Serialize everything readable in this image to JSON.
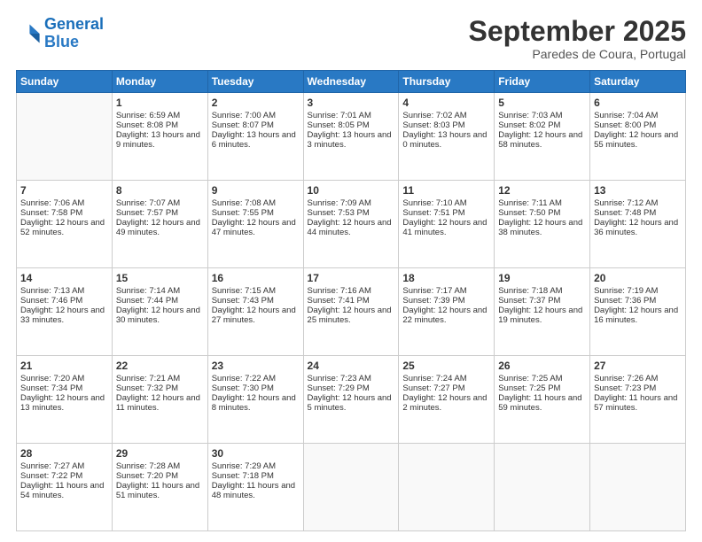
{
  "logo": {
    "line1": "General",
    "line2": "Blue"
  },
  "header": {
    "month": "September 2025",
    "location": "Paredes de Coura, Portugal"
  },
  "days_of_week": [
    "Sunday",
    "Monday",
    "Tuesday",
    "Wednesday",
    "Thursday",
    "Friday",
    "Saturday"
  ],
  "weeks": [
    [
      {
        "day": "",
        "sunrise": "",
        "sunset": "",
        "daylight": "",
        "empty": true
      },
      {
        "day": "1",
        "sunrise": "Sunrise: 6:59 AM",
        "sunset": "Sunset: 8:08 PM",
        "daylight": "Daylight: 13 hours and 9 minutes."
      },
      {
        "day": "2",
        "sunrise": "Sunrise: 7:00 AM",
        "sunset": "Sunset: 8:07 PM",
        "daylight": "Daylight: 13 hours and 6 minutes."
      },
      {
        "day": "3",
        "sunrise": "Sunrise: 7:01 AM",
        "sunset": "Sunset: 8:05 PM",
        "daylight": "Daylight: 13 hours and 3 minutes."
      },
      {
        "day": "4",
        "sunrise": "Sunrise: 7:02 AM",
        "sunset": "Sunset: 8:03 PM",
        "daylight": "Daylight: 13 hours and 0 minutes."
      },
      {
        "day": "5",
        "sunrise": "Sunrise: 7:03 AM",
        "sunset": "Sunset: 8:02 PM",
        "daylight": "Daylight: 12 hours and 58 minutes."
      },
      {
        "day": "6",
        "sunrise": "Sunrise: 7:04 AM",
        "sunset": "Sunset: 8:00 PM",
        "daylight": "Daylight: 12 hours and 55 minutes."
      }
    ],
    [
      {
        "day": "7",
        "sunrise": "Sunrise: 7:06 AM",
        "sunset": "Sunset: 7:58 PM",
        "daylight": "Daylight: 12 hours and 52 minutes."
      },
      {
        "day": "8",
        "sunrise": "Sunrise: 7:07 AM",
        "sunset": "Sunset: 7:57 PM",
        "daylight": "Daylight: 12 hours and 49 minutes."
      },
      {
        "day": "9",
        "sunrise": "Sunrise: 7:08 AM",
        "sunset": "Sunset: 7:55 PM",
        "daylight": "Daylight: 12 hours and 47 minutes."
      },
      {
        "day": "10",
        "sunrise": "Sunrise: 7:09 AM",
        "sunset": "Sunset: 7:53 PM",
        "daylight": "Daylight: 12 hours and 44 minutes."
      },
      {
        "day": "11",
        "sunrise": "Sunrise: 7:10 AM",
        "sunset": "Sunset: 7:51 PM",
        "daylight": "Daylight: 12 hours and 41 minutes."
      },
      {
        "day": "12",
        "sunrise": "Sunrise: 7:11 AM",
        "sunset": "Sunset: 7:50 PM",
        "daylight": "Daylight: 12 hours and 38 minutes."
      },
      {
        "day": "13",
        "sunrise": "Sunrise: 7:12 AM",
        "sunset": "Sunset: 7:48 PM",
        "daylight": "Daylight: 12 hours and 36 minutes."
      }
    ],
    [
      {
        "day": "14",
        "sunrise": "Sunrise: 7:13 AM",
        "sunset": "Sunset: 7:46 PM",
        "daylight": "Daylight: 12 hours and 33 minutes."
      },
      {
        "day": "15",
        "sunrise": "Sunrise: 7:14 AM",
        "sunset": "Sunset: 7:44 PM",
        "daylight": "Daylight: 12 hours and 30 minutes."
      },
      {
        "day": "16",
        "sunrise": "Sunrise: 7:15 AM",
        "sunset": "Sunset: 7:43 PM",
        "daylight": "Daylight: 12 hours and 27 minutes."
      },
      {
        "day": "17",
        "sunrise": "Sunrise: 7:16 AM",
        "sunset": "Sunset: 7:41 PM",
        "daylight": "Daylight: 12 hours and 25 minutes."
      },
      {
        "day": "18",
        "sunrise": "Sunrise: 7:17 AM",
        "sunset": "Sunset: 7:39 PM",
        "daylight": "Daylight: 12 hours and 22 minutes."
      },
      {
        "day": "19",
        "sunrise": "Sunrise: 7:18 AM",
        "sunset": "Sunset: 7:37 PM",
        "daylight": "Daylight: 12 hours and 19 minutes."
      },
      {
        "day": "20",
        "sunrise": "Sunrise: 7:19 AM",
        "sunset": "Sunset: 7:36 PM",
        "daylight": "Daylight: 12 hours and 16 minutes."
      }
    ],
    [
      {
        "day": "21",
        "sunrise": "Sunrise: 7:20 AM",
        "sunset": "Sunset: 7:34 PM",
        "daylight": "Daylight: 12 hours and 13 minutes."
      },
      {
        "day": "22",
        "sunrise": "Sunrise: 7:21 AM",
        "sunset": "Sunset: 7:32 PM",
        "daylight": "Daylight: 12 hours and 11 minutes."
      },
      {
        "day": "23",
        "sunrise": "Sunrise: 7:22 AM",
        "sunset": "Sunset: 7:30 PM",
        "daylight": "Daylight: 12 hours and 8 minutes."
      },
      {
        "day": "24",
        "sunrise": "Sunrise: 7:23 AM",
        "sunset": "Sunset: 7:29 PM",
        "daylight": "Daylight: 12 hours and 5 minutes."
      },
      {
        "day": "25",
        "sunrise": "Sunrise: 7:24 AM",
        "sunset": "Sunset: 7:27 PM",
        "daylight": "Daylight: 12 hours and 2 minutes."
      },
      {
        "day": "26",
        "sunrise": "Sunrise: 7:25 AM",
        "sunset": "Sunset: 7:25 PM",
        "daylight": "Daylight: 11 hours and 59 minutes."
      },
      {
        "day": "27",
        "sunrise": "Sunrise: 7:26 AM",
        "sunset": "Sunset: 7:23 PM",
        "daylight": "Daylight: 11 hours and 57 minutes."
      }
    ],
    [
      {
        "day": "28",
        "sunrise": "Sunrise: 7:27 AM",
        "sunset": "Sunset: 7:22 PM",
        "daylight": "Daylight: 11 hours and 54 minutes."
      },
      {
        "day": "29",
        "sunrise": "Sunrise: 7:28 AM",
        "sunset": "Sunset: 7:20 PM",
        "daylight": "Daylight: 11 hours and 51 minutes."
      },
      {
        "day": "30",
        "sunrise": "Sunrise: 7:29 AM",
        "sunset": "Sunset: 7:18 PM",
        "daylight": "Daylight: 11 hours and 48 minutes."
      },
      {
        "day": "",
        "sunrise": "",
        "sunset": "",
        "daylight": "",
        "empty": true
      },
      {
        "day": "",
        "sunrise": "",
        "sunset": "",
        "daylight": "",
        "empty": true
      },
      {
        "day": "",
        "sunrise": "",
        "sunset": "",
        "daylight": "",
        "empty": true
      },
      {
        "day": "",
        "sunrise": "",
        "sunset": "",
        "daylight": "",
        "empty": true
      }
    ]
  ]
}
